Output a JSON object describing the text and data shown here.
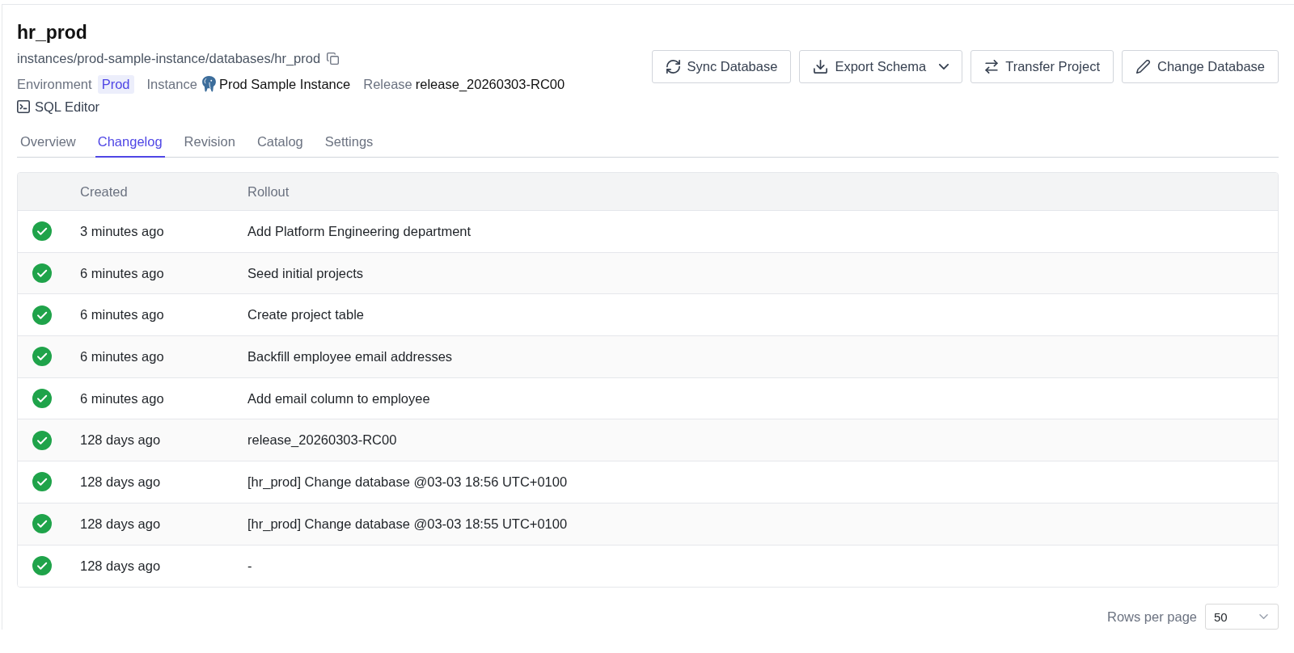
{
  "database": {
    "name": "hr_prod",
    "path": "instances/prod-sample-instance/databases/hr_prod",
    "meta": [
      {
        "label": "Environment",
        "value": "Prod",
        "kind": "badge"
      },
      {
        "label": "Instance",
        "value": "Prod Sample Instance",
        "kind": "instance"
      },
      {
        "label": "Release",
        "value": "release_20260303-RC00",
        "kind": "text"
      }
    ],
    "sql_editor": "SQL Editor"
  },
  "actions": [
    {
      "label": "Sync Database",
      "kind": "sync",
      "dropdown": false
    },
    {
      "label": "Export Schema",
      "kind": "export",
      "dropdown": true
    },
    {
      "label": "Transfer Project",
      "kind": "transfer",
      "dropdown": false
    },
    {
      "label": "Change Database",
      "kind": "edit",
      "dropdown": false
    }
  ],
  "tabs": [
    {
      "label": "Overview",
      "selected": false
    },
    {
      "label": "Changelog",
      "selected": true
    },
    {
      "label": "Revision",
      "selected": false
    },
    {
      "label": "Catalog",
      "selected": false
    },
    {
      "label": "Settings",
      "selected": false
    }
  ],
  "table": {
    "columns": [
      "Created",
      "Rollout"
    ],
    "rows": [
      {
        "done": true,
        "created": "3 minutes ago",
        "rollout": "Add Platform Engineering department"
      },
      {
        "done": true,
        "created": "6 minutes ago",
        "rollout": "Seed initial projects"
      },
      {
        "done": true,
        "created": "6 minutes ago",
        "rollout": "Create project table"
      },
      {
        "done": true,
        "created": "6 minutes ago",
        "rollout": "Backfill employee email addresses"
      },
      {
        "done": true,
        "created": "6 minutes ago",
        "rollout": "Add email column to employee"
      },
      {
        "done": true,
        "created": "128 days ago",
        "rollout": "release_20260303-RC00"
      },
      {
        "done": true,
        "created": "128 days ago",
        "rollout": "[hr_prod] Change database @03-03 18:56 UTC+0100"
      },
      {
        "done": true,
        "created": "128 days ago",
        "rollout": "[hr_prod] Change database @03-03 18:55 UTC+0100"
      },
      {
        "done": true,
        "created": "128 days ago",
        "rollout": "-"
      }
    ]
  },
  "pagination": {
    "label": "Rows per page",
    "value": "50"
  }
}
